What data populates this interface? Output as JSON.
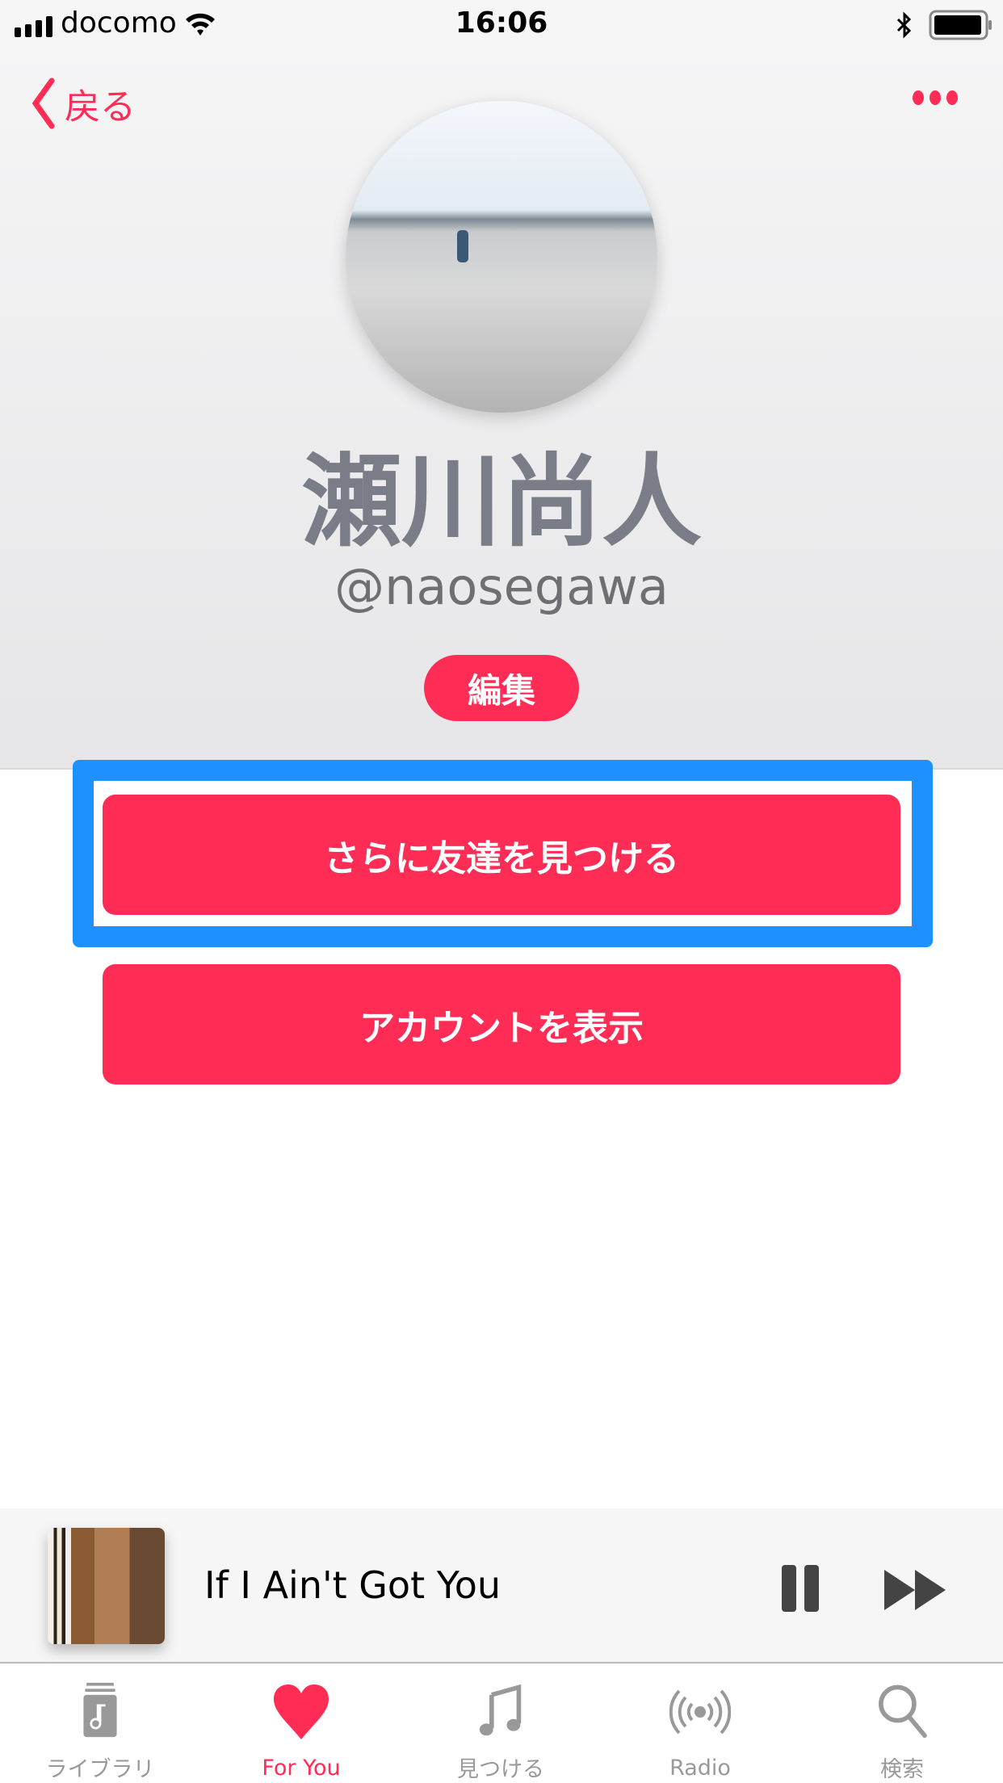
{
  "status": {
    "carrier": "docomo",
    "time": "16:06"
  },
  "nav": {
    "back_label": "戻る"
  },
  "profile": {
    "name": "瀬川尚人",
    "handle": "@naosegawa",
    "edit_label": "編集"
  },
  "actions": {
    "find_friends": "さらに友達を見つける",
    "view_account": "アカウントを表示"
  },
  "player": {
    "song": "If I Ain't Got You"
  },
  "tabs": [
    {
      "label": "ライブラリ",
      "icon": "library-icon"
    },
    {
      "label": "For You",
      "icon": "heart-icon",
      "active": true
    },
    {
      "label": "見つける",
      "icon": "music-note-icon"
    },
    {
      "label": "Radio",
      "icon": "radio-icon"
    },
    {
      "label": "検索",
      "icon": "search-icon"
    }
  ],
  "colors": {
    "accent": "#ff2d55",
    "highlight": "#1e90ff"
  }
}
